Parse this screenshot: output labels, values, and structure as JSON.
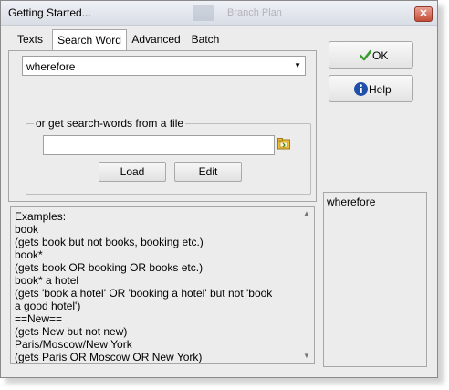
{
  "window": {
    "title": "Getting Started...",
    "close_glyph": "✕",
    "background_title": "Branch Plan"
  },
  "tabs": [
    {
      "label": "Texts"
    },
    {
      "label": "Search Word"
    },
    {
      "label": "Advanced"
    },
    {
      "label": "Batch"
    }
  ],
  "search": {
    "value": "wherefore"
  },
  "file_group": {
    "legend": "or get search-words from a file",
    "path_value": "",
    "load_label": "Load",
    "edit_label": "Edit"
  },
  "examples": {
    "lines": [
      "Examples:",
      "book",
      "  (gets book but not books, booking etc.)",
      "book*",
      "  (gets book OR booking OR books etc.)",
      "book* a hotel",
      "  (gets 'book a hotel' OR 'booking a hotel' but not 'book",
      "a good hotel')",
      "==New==",
      "  (gets New but not new)",
      "Paris/Moscow/New York",
      "  (gets Paris OR Moscow OR New York)"
    ]
  },
  "buttons": {
    "ok_label": "OK",
    "help_label": "Help"
  },
  "words_list": {
    "items": [
      "wherefore"
    ]
  },
  "colors": {
    "ok_check": "#3a9c2f",
    "help_icon": "#1f4fa8"
  }
}
